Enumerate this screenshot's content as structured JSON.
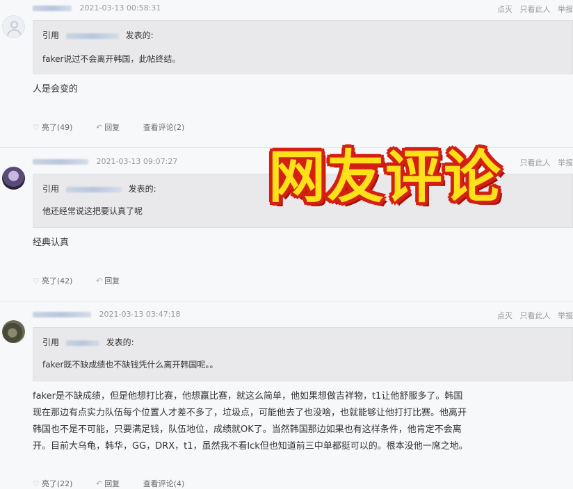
{
  "posts": [
    {
      "time": "2021-03-13 00:58:31",
      "actions": [
        "点灭",
        "只看此人",
        "举报"
      ],
      "quote_prefix": "引用",
      "quote_suffix": "发表的:",
      "quote_text": "faker说过不会离开韩国，此帖终结。",
      "body": [
        "人是会变的"
      ],
      "likes": "亮了(49)",
      "reply": "回复",
      "comments": "查看评论(2)"
    },
    {
      "time": "2021-03-13 09:07:27",
      "actions": [
        "只看此人",
        "举报"
      ],
      "quote_prefix": "引用",
      "quote_suffix": "发表的:",
      "quote_text": "他还经常说这把要认真了呢",
      "body": [
        "经典认真"
      ],
      "likes": "亮了(42)",
      "reply": "回复",
      "comments": ""
    },
    {
      "time": "2021-03-13 03:47:18",
      "actions": [
        "点灭",
        "只看此人",
        "举报"
      ],
      "quote_prefix": "引用",
      "quote_suffix": "发表的:",
      "quote_text": "faker既不缺成绩也不缺钱凭什么离开韩国呢。。",
      "body": [
        "faker是不缺成绩，但是他想打比赛，他想赢比赛，就这么简单，他如果想做吉祥物，t1让他舒服多了。韩国",
        "现在那边有点实力队伍每个位置人才差不多了，垃圾点，可能他去了也没啥，也就能够让他打打比赛。他离开",
        "韩国也不是不可能，只要满足钱，队伍地位，成绩就OK了。当然韩国那边如果也有这样条件，他肯定不会离",
        "开。目前大乌龟，韩华，GG，DRX，t1，虽然我不看lck但也知道前三中单都挺可以的。根本没他一席之地。"
      ],
      "likes": "亮了(22)",
      "reply": "回复",
      "comments": "查看评论(4)"
    }
  ],
  "overlay_title": "网友评论"
}
